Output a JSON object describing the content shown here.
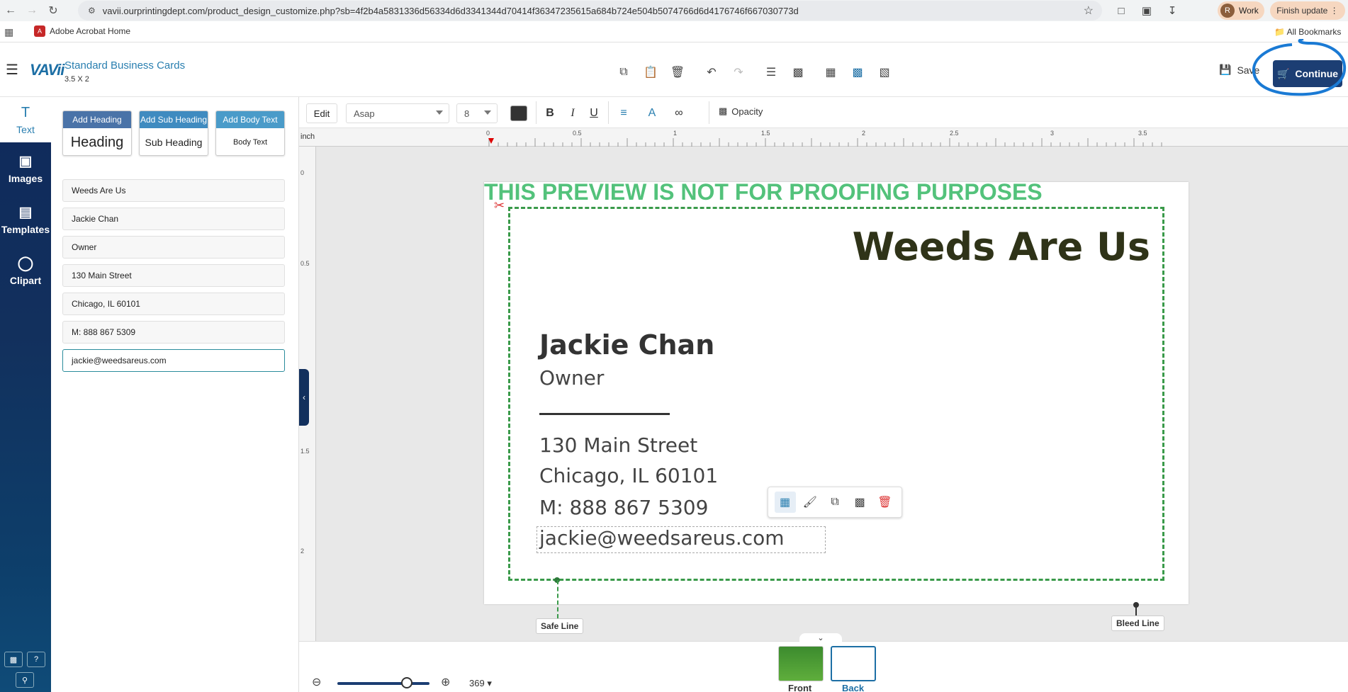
{
  "browser": {
    "url": "vavii.ourprintingdept.com/product_design_customize.php?sb=4f2b4a5831336d56334d6d3341344d70414f36347235615a684b724e504b5074766d6d4176746f667030773d",
    "profile_initial": "R",
    "profile_label": "Work",
    "update_label": "Finish update",
    "bookmark_acrobat": "Adobe Acrobat Home",
    "bookmark_all": "All Bookmarks"
  },
  "header": {
    "logo": "VAVii",
    "product_title": "Standard Business Cards",
    "product_size": "3.5 X 2",
    "save_label": "Save",
    "continue_label": "Continue"
  },
  "rail": {
    "items": [
      {
        "label": "Text",
        "icon": "text-icon"
      },
      {
        "label": "Images",
        "icon": "image-icon"
      },
      {
        "label": "Templates",
        "icon": "templates-icon"
      },
      {
        "label": "Clipart",
        "icon": "clipart-icon"
      }
    ]
  },
  "panel": {
    "add_heading": "Add Heading",
    "add_heading_sample": "Heading",
    "add_sub_heading": "Add Sub Heading",
    "add_sub_heading_sample": "Sub Heading",
    "add_body_text": "Add Body Text",
    "add_body_text_sample": "Body Text",
    "text_fields": [
      "Weeds Are Us",
      "Jackie Chan",
      "Owner",
      "130 Main Street",
      "Chicago, IL 60101",
      "M: 888 867 5309",
      "jackie@weedsareus.com"
    ]
  },
  "format": {
    "edit_label": "Edit",
    "font": "Asap",
    "size": "8",
    "color": "#333333",
    "opacity_label": "Opacity"
  },
  "canvas": {
    "ruler_unit": "inch",
    "ruler_top": [
      "0",
      "0.5",
      "1",
      "1.5",
      "2",
      "2.5",
      "3",
      "3.5"
    ],
    "ruler_left": [
      "0",
      "0.5",
      "1.5",
      "2"
    ],
    "watermark": "THIS PREVIEW IS NOT FOR PROOFING PURPOSES",
    "company": "Weeds Are Us",
    "name": "Jackie Chan",
    "title": "Owner",
    "address1": "130 Main Street",
    "address2": "Chicago, IL 60101",
    "phone": "M: 888 867 5309",
    "email": "jackie@weedsareus.com",
    "safe_line_label": "Safe Line",
    "bleed_line_label": "Bleed Line"
  },
  "bottom": {
    "zoom": "369",
    "zoom_fraction": 0.75,
    "front_label": "Front",
    "back_label": "Back"
  },
  "colors": {
    "accent": "#1c3e73",
    "watermark": "#53c27b",
    "safe_line": "#3a9a4a"
  }
}
